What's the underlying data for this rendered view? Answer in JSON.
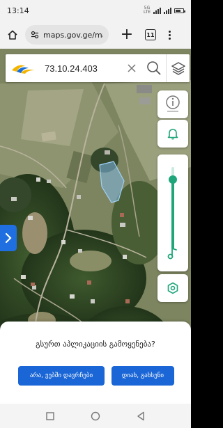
{
  "status_bar": {
    "time": "13:14",
    "network_top": "5G",
    "network_bottom": "LTE",
    "battery_level": 0.6
  },
  "browser": {
    "url": "maps.gov.ge/map",
    "tab_count": "11",
    "icons": [
      "home-icon",
      "tune-icon",
      "plus-icon",
      "tabs-icon",
      "more-vert-icon"
    ]
  },
  "map": {
    "search_value": "73.10.24.403",
    "icons": [
      "napr-logo",
      "close-icon",
      "search-icon",
      "layers-icon",
      "info-icon",
      "bell-icon",
      "music-note-icon",
      "gps-icon",
      "chevron-right-icon"
    ],
    "volume_level": 0.85,
    "accent": "#1fa57a",
    "parcel_color": "#7fb8e6"
  },
  "dialog": {
    "question": "გსურთ აპლიკაციის გამოყენება?",
    "no_label": "არა, ვებში დავრჩები",
    "yes_label": "დიახ, გახსენი",
    "button_color": "#1a66d6"
  },
  "nav": {
    "icons": [
      "square-icon",
      "circle-icon",
      "back-triangle-icon"
    ]
  }
}
